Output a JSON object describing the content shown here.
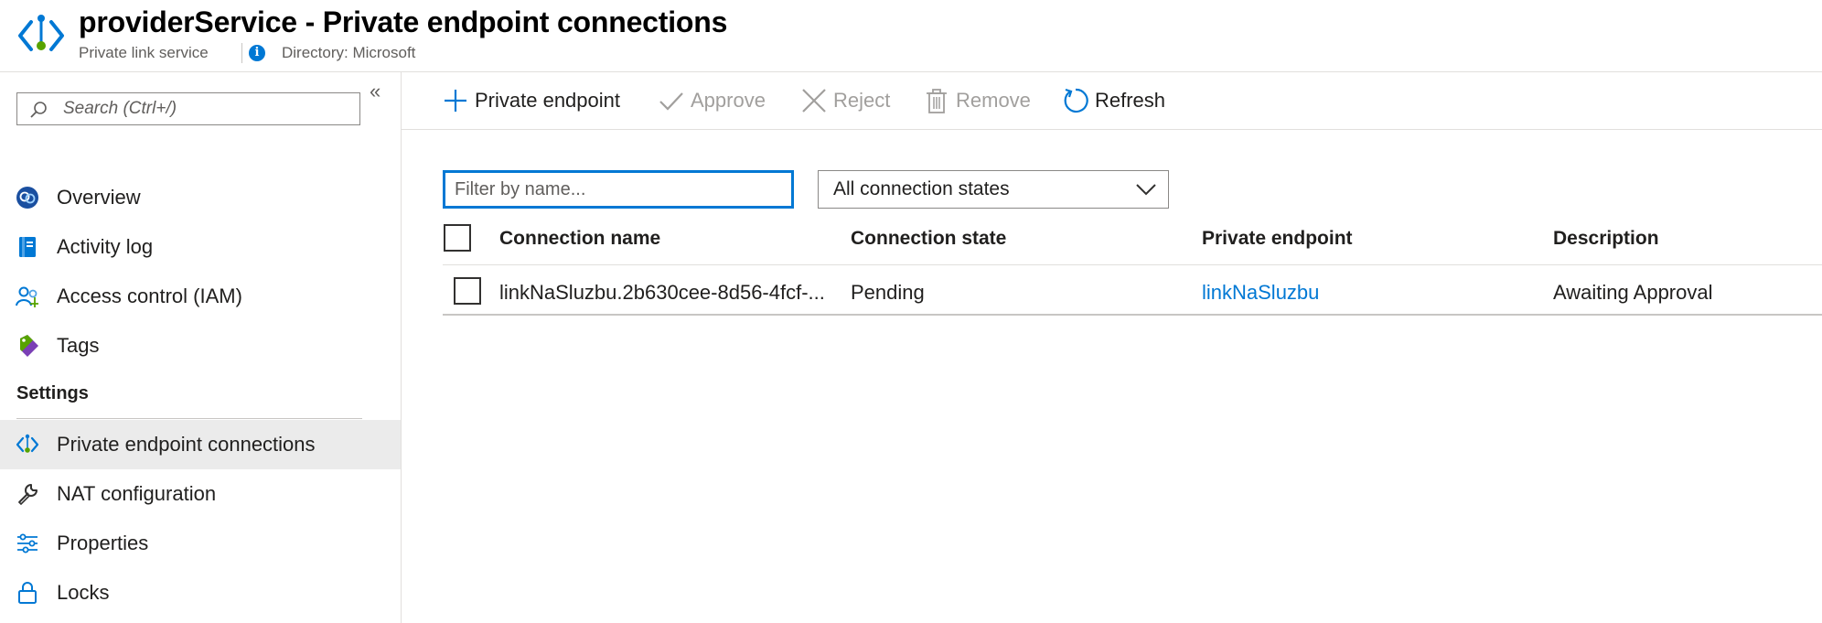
{
  "header": {
    "title": "providerService - Private endpoint connections",
    "subtitle": "Private link service",
    "directory": "Directory: Microsoft",
    "info_glyph": "i",
    "brand_color": "#0078d4"
  },
  "sidebar": {
    "search_placeholder": "Search (Ctrl+/)",
    "collapse_glyph": "«",
    "items": [
      {
        "label": "Overview",
        "icon": "overview-icon"
      },
      {
        "label": "Activity log",
        "icon": "activity-log-icon"
      },
      {
        "label": "Access control (IAM)",
        "icon": "access-control-icon"
      },
      {
        "label": "Tags",
        "icon": "tag-icon"
      }
    ],
    "settings_heading": "Settings",
    "settings_items": [
      {
        "label": "Private endpoint connections",
        "icon": "private-link-icon",
        "active": true
      },
      {
        "label": "NAT configuration",
        "icon": "wrench-icon"
      },
      {
        "label": "Properties",
        "icon": "sliders-icon"
      },
      {
        "label": "Locks",
        "icon": "lock-icon"
      }
    ]
  },
  "toolbar": {
    "add_label": "Private endpoint",
    "approve_label": "Approve",
    "reject_label": "Reject",
    "remove_label": "Remove",
    "refresh_label": "Refresh"
  },
  "filter": {
    "placeholder": "Filter by name...",
    "state_selected": "All connection states"
  },
  "table": {
    "columns": [
      "Connection name",
      "Connection state",
      "Private endpoint",
      "Description"
    ],
    "rows": [
      {
        "name": "linkNaSluzbu.2b630cee-8d56-4fcf-...",
        "state": "Pending",
        "endpoint": "linkNaSluzbu",
        "description": "Awaiting Approval"
      }
    ]
  }
}
